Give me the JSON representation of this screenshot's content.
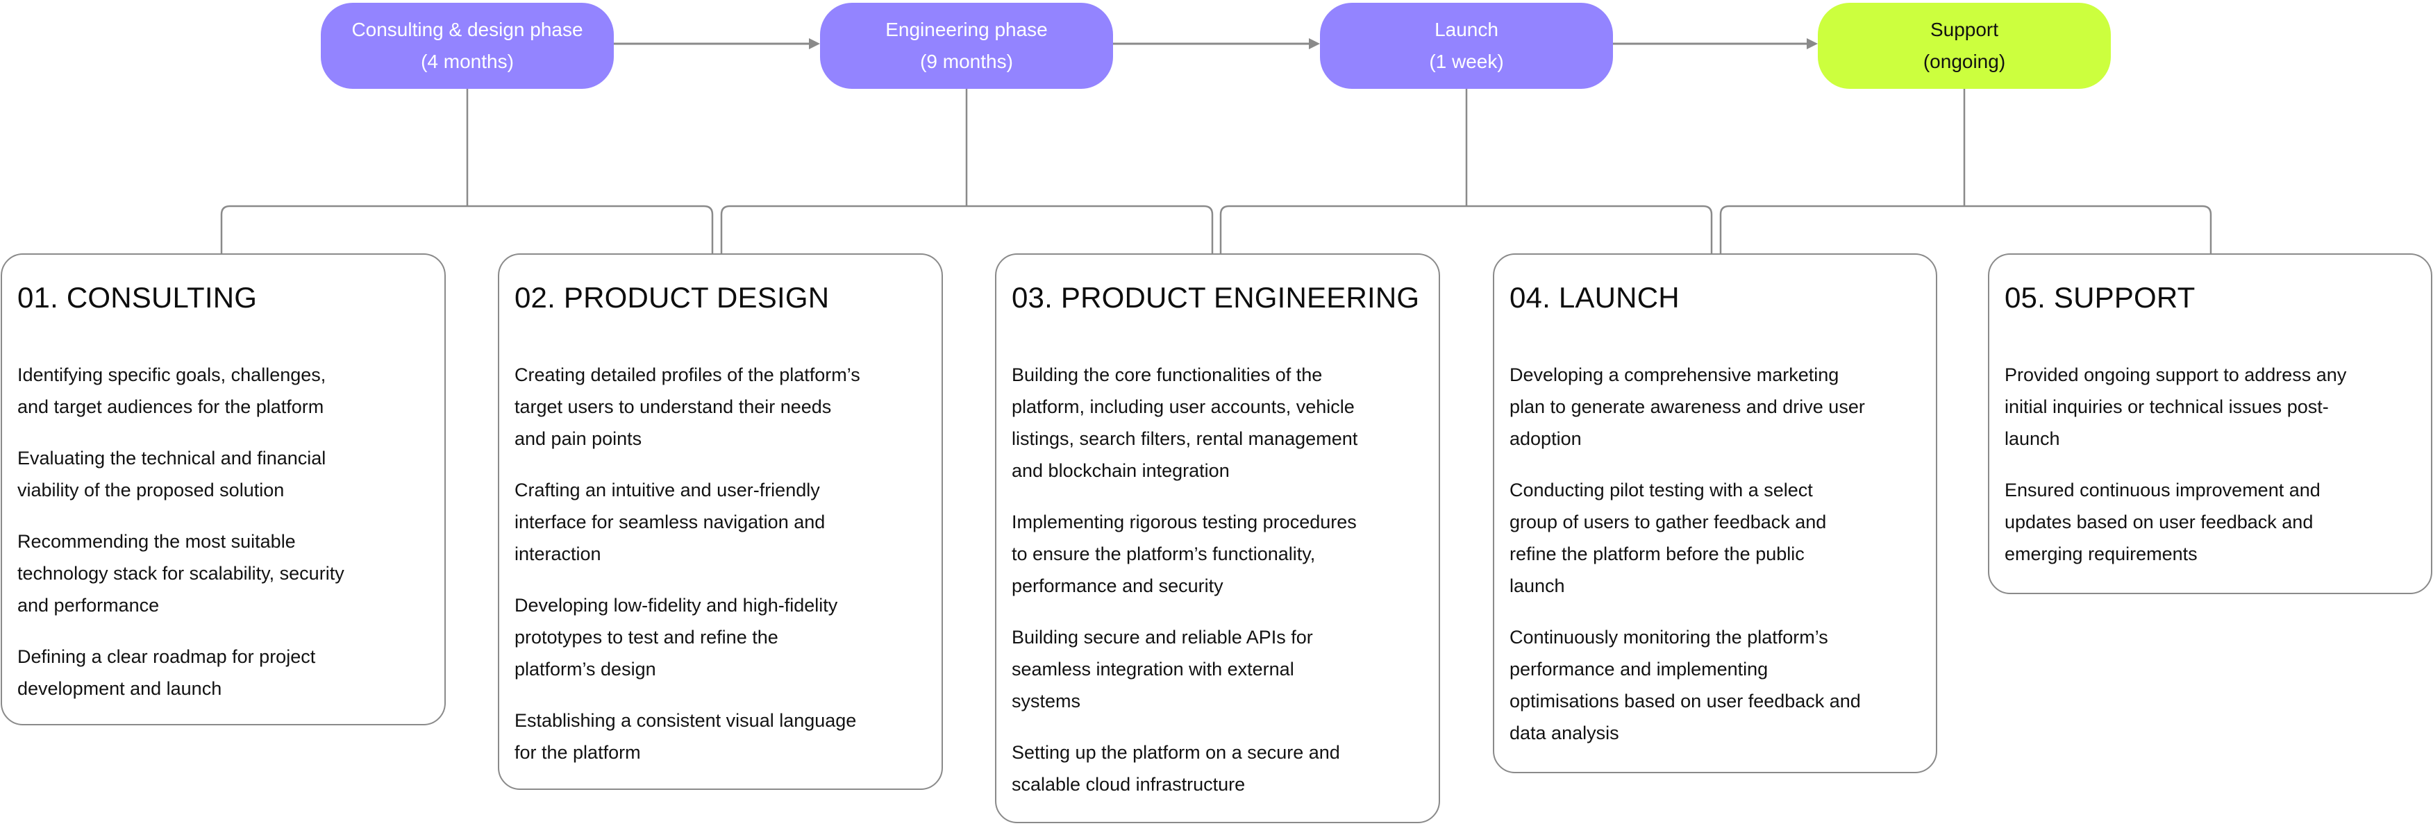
{
  "colors": {
    "phase_active": "#9384FF",
    "phase_ongoing": "#CCFF3E",
    "connector": "#8A8A8A",
    "card_border": "#8A8A8A"
  },
  "phases": [
    {
      "name": "Consulting & design phase",
      "duration": "(4 months)",
      "style": "purple"
    },
    {
      "name": "Engineering phase",
      "duration": "(9 months)",
      "style": "purple"
    },
    {
      "name": "Launch",
      "duration": "(1 week)",
      "style": "purple"
    },
    {
      "name": "Support",
      "duration": "(ongoing)",
      "style": "lime"
    }
  ],
  "stages": [
    {
      "title": "01. CONSULTING",
      "items": [
        "Identifying specific goals, challenges,\nand target audiences for the platform",
        "Evaluating the technical and financial\nviability of the proposed solution",
        "Recommending the most suitable\ntechnology stack for scalability, security\nand performance",
        "Defining a clear roadmap for project\ndevelopment and launch"
      ]
    },
    {
      "title": "02. PRODUCT DESIGN",
      "items": [
        "Creating detailed profiles of the platform’s\ntarget users to understand their needs\nand pain points",
        "Crafting an intuitive and user-friendly\ninterface for seamless navigation and\ninteraction",
        "Developing low-fidelity and high-fidelity\nprototypes to test and refine the\nplatform’s design",
        "Establishing a consistent visual language\nfor the platform"
      ]
    },
    {
      "title": "03. PRODUCT ENGINEERING",
      "items": [
        "Building the core functionalities of the\nplatform, including user accounts, vehicle\nlistings, search filters, rental management\nand blockchain integration",
        "Implementing rigorous testing procedures\nto ensure the platform’s functionality,\nperformance and security",
        "Building secure and reliable APIs for\nseamless integration with external\nsystems",
        "Setting up the platform on a secure and\nscalable cloud infrastructure"
      ]
    },
    {
      "title": "04. LAUNCH",
      "items": [
        "Developing a comprehensive marketing\nplan to generate awareness and drive user\nadoption",
        "Conducting pilot testing with a select\ngroup of users to gather feedback and\nrefine the platform before the public\nlaunch",
        "Continuously monitoring the platform’s\nperformance and implementing\noptimisations based on user feedback and\ndata analysis"
      ]
    },
    {
      "title": "05. SUPPORT",
      "items": [
        "Provided ongoing support to address any\ninitial inquiries or technical issues post-\nlaunch",
        "Ensured continuous improvement and\nupdates based on user feedback and\nemerging requirements"
      ]
    }
  ]
}
